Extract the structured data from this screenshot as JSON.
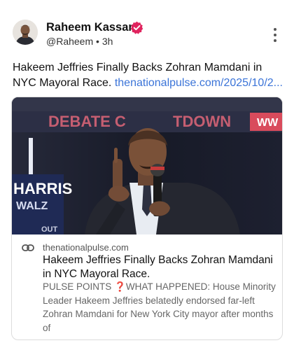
{
  "author": {
    "name": "Raheem Kassam",
    "handle": "@Raheem",
    "separator": "•",
    "time": "3h"
  },
  "post": {
    "text": "Hakeem Jeffries Finally Backs Zohran Mamdani in NYC Mayoral Race.",
    "link_text": "thenationalpulse.com/2025/10/2..."
  },
  "card": {
    "image_text": {
      "banner_left": "DEBATE C",
      "banner_right": "TDOWN",
      "sign_line1": "HARRIS",
      "sign_line2": "WALZ",
      "corner": "WW",
      "bottom": "OUT"
    },
    "domain": "thenationalpulse.com",
    "title": "Hakeem Jeffries Finally Backs Zohran Mamdani in NYC Mayoral Race.",
    "description": "PULSE POINTS ❓WHAT HAPPENED: House Minority Leader Hakeem Jeffries belatedly endorsed far-left Zohran Mamdani for New York City mayor after months of"
  },
  "colors": {
    "verified": "#e0245e",
    "link": "#3b74d8",
    "banner_text": "#ec6a7c"
  },
  "icons": {
    "more": "more-vertical-icon",
    "verified": "verified-badge-icon",
    "link": "link-icon"
  }
}
